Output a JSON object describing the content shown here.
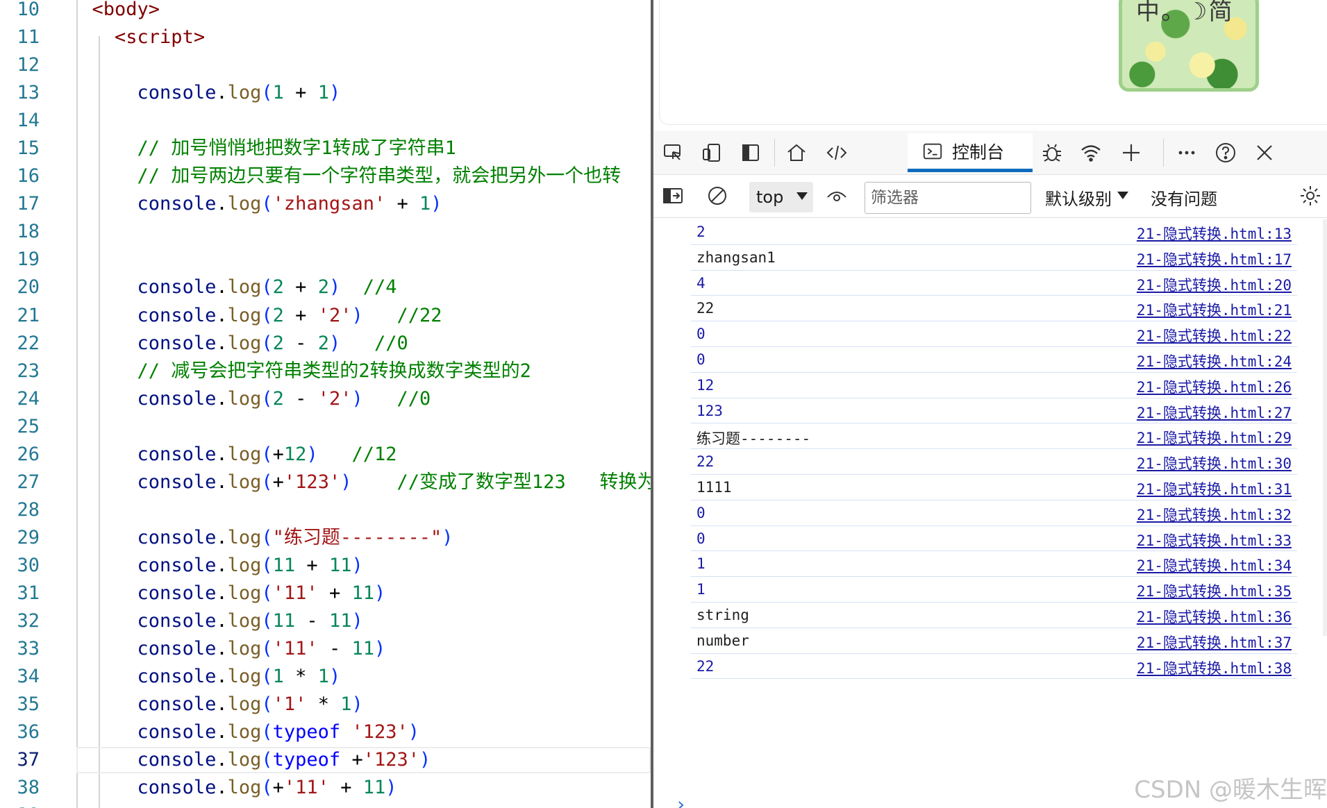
{
  "editor": {
    "lines": [
      {
        "n": "10",
        "tokens": [
          {
            "t": "  "
          },
          {
            "t": "<body>",
            "c": "tag"
          }
        ]
      },
      {
        "n": "11",
        "tokens": [
          {
            "t": "    "
          },
          {
            "t": "<script>",
            "c": "tag"
          }
        ]
      },
      {
        "n": "12",
        "tokens": []
      },
      {
        "n": "13",
        "tokens": [
          {
            "t": "      "
          },
          {
            "t": "console",
            "c": "obj"
          },
          {
            "t": ".",
            "c": "op"
          },
          {
            "t": "log",
            "c": "fn"
          },
          {
            "t": "(",
            "c": "pun"
          },
          {
            "t": "1",
            "c": "num"
          },
          {
            "t": " + ",
            "c": "op"
          },
          {
            "t": "1",
            "c": "num"
          },
          {
            "t": ")",
            "c": "pun"
          }
        ]
      },
      {
        "n": "14",
        "tokens": []
      },
      {
        "n": "15",
        "tokens": [
          {
            "t": "      "
          },
          {
            "t": "// 加号悄悄地把数字1转成了字符串1",
            "c": "cm"
          }
        ]
      },
      {
        "n": "16",
        "tokens": [
          {
            "t": "      "
          },
          {
            "t": "// 加号两边只要有一个字符串类型，就会把另外一个也转",
            "c": "cm"
          }
        ]
      },
      {
        "n": "17",
        "tokens": [
          {
            "t": "      "
          },
          {
            "t": "console",
            "c": "obj"
          },
          {
            "t": ".",
            "c": "op"
          },
          {
            "t": "log",
            "c": "fn"
          },
          {
            "t": "(",
            "c": "pun"
          },
          {
            "t": "'zhangsan'",
            "c": "str"
          },
          {
            "t": " + ",
            "c": "op"
          },
          {
            "t": "1",
            "c": "num"
          },
          {
            "t": ")",
            "c": "pun"
          }
        ]
      },
      {
        "n": "18",
        "tokens": []
      },
      {
        "n": "19",
        "tokens": []
      },
      {
        "n": "20",
        "tokens": [
          {
            "t": "      "
          },
          {
            "t": "console",
            "c": "obj"
          },
          {
            "t": ".",
            "c": "op"
          },
          {
            "t": "log",
            "c": "fn"
          },
          {
            "t": "(",
            "c": "pun"
          },
          {
            "t": "2",
            "c": "num"
          },
          {
            "t": " + ",
            "c": "op"
          },
          {
            "t": "2",
            "c": "num"
          },
          {
            "t": ")",
            "c": "pun"
          },
          {
            "t": "  //4",
            "c": "cm"
          }
        ]
      },
      {
        "n": "21",
        "tokens": [
          {
            "t": "      "
          },
          {
            "t": "console",
            "c": "obj"
          },
          {
            "t": ".",
            "c": "op"
          },
          {
            "t": "log",
            "c": "fn"
          },
          {
            "t": "(",
            "c": "pun"
          },
          {
            "t": "2",
            "c": "num"
          },
          {
            "t": " + ",
            "c": "op"
          },
          {
            "t": "'2'",
            "c": "str"
          },
          {
            "t": ")",
            "c": "pun"
          },
          {
            "t": "   //22",
            "c": "cm"
          }
        ]
      },
      {
        "n": "22",
        "tokens": [
          {
            "t": "      "
          },
          {
            "t": "console",
            "c": "obj"
          },
          {
            "t": ".",
            "c": "op"
          },
          {
            "t": "log",
            "c": "fn"
          },
          {
            "t": "(",
            "c": "pun"
          },
          {
            "t": "2",
            "c": "num"
          },
          {
            "t": " - ",
            "c": "op"
          },
          {
            "t": "2",
            "c": "num"
          },
          {
            "t": ")",
            "c": "pun"
          },
          {
            "t": "   //0",
            "c": "cm"
          }
        ]
      },
      {
        "n": "23",
        "tokens": [
          {
            "t": "      "
          },
          {
            "t": "// 减号会把字符串类型的2转换成数字类型的2",
            "c": "cm"
          }
        ]
      },
      {
        "n": "24",
        "tokens": [
          {
            "t": "      "
          },
          {
            "t": "console",
            "c": "obj"
          },
          {
            "t": ".",
            "c": "op"
          },
          {
            "t": "log",
            "c": "fn"
          },
          {
            "t": "(",
            "c": "pun"
          },
          {
            "t": "2",
            "c": "num"
          },
          {
            "t": " - ",
            "c": "op"
          },
          {
            "t": "'2'",
            "c": "str"
          },
          {
            "t": ")",
            "c": "pun"
          },
          {
            "t": "   //0",
            "c": "cm"
          }
        ]
      },
      {
        "n": "25",
        "tokens": []
      },
      {
        "n": "26",
        "tokens": [
          {
            "t": "      "
          },
          {
            "t": "console",
            "c": "obj"
          },
          {
            "t": ".",
            "c": "op"
          },
          {
            "t": "log",
            "c": "fn"
          },
          {
            "t": "(",
            "c": "pun"
          },
          {
            "t": "+",
            "c": "op"
          },
          {
            "t": "12",
            "c": "num"
          },
          {
            "t": ")",
            "c": "pun"
          },
          {
            "t": "   //12",
            "c": "cm"
          }
        ]
      },
      {
        "n": "27",
        "tokens": [
          {
            "t": "      "
          },
          {
            "t": "console",
            "c": "obj"
          },
          {
            "t": ".",
            "c": "op"
          },
          {
            "t": "log",
            "c": "fn"
          },
          {
            "t": "(",
            "c": "pun"
          },
          {
            "t": "+",
            "c": "op"
          },
          {
            "t": "'123'",
            "c": "str"
          },
          {
            "t": ")",
            "c": "pun"
          },
          {
            "t": "    //变成了数字型123   转换为",
            "c": "cm"
          }
        ]
      },
      {
        "n": "28",
        "tokens": []
      },
      {
        "n": "29",
        "tokens": [
          {
            "t": "      "
          },
          {
            "t": "console",
            "c": "obj"
          },
          {
            "t": ".",
            "c": "op"
          },
          {
            "t": "log",
            "c": "fn"
          },
          {
            "t": "(",
            "c": "pun"
          },
          {
            "t": "\"练习题--------\"",
            "c": "str"
          },
          {
            "t": ")",
            "c": "pun"
          }
        ]
      },
      {
        "n": "30",
        "tokens": [
          {
            "t": "      "
          },
          {
            "t": "console",
            "c": "obj"
          },
          {
            "t": ".",
            "c": "op"
          },
          {
            "t": "log",
            "c": "fn"
          },
          {
            "t": "(",
            "c": "pun"
          },
          {
            "t": "11",
            "c": "num"
          },
          {
            "t": " + ",
            "c": "op"
          },
          {
            "t": "11",
            "c": "num"
          },
          {
            "t": ")",
            "c": "pun"
          }
        ]
      },
      {
        "n": "31",
        "tokens": [
          {
            "t": "      "
          },
          {
            "t": "console",
            "c": "obj"
          },
          {
            "t": ".",
            "c": "op"
          },
          {
            "t": "log",
            "c": "fn"
          },
          {
            "t": "(",
            "c": "pun"
          },
          {
            "t": "'11'",
            "c": "str"
          },
          {
            "t": " + ",
            "c": "op"
          },
          {
            "t": "11",
            "c": "num"
          },
          {
            "t": ")",
            "c": "pun"
          }
        ]
      },
      {
        "n": "32",
        "tokens": [
          {
            "t": "      "
          },
          {
            "t": "console",
            "c": "obj"
          },
          {
            "t": ".",
            "c": "op"
          },
          {
            "t": "log",
            "c": "fn"
          },
          {
            "t": "(",
            "c": "pun"
          },
          {
            "t": "11",
            "c": "num"
          },
          {
            "t": " - ",
            "c": "op"
          },
          {
            "t": "11",
            "c": "num"
          },
          {
            "t": ")",
            "c": "pun"
          }
        ]
      },
      {
        "n": "33",
        "tokens": [
          {
            "t": "      "
          },
          {
            "t": "console",
            "c": "obj"
          },
          {
            "t": ".",
            "c": "op"
          },
          {
            "t": "log",
            "c": "fn"
          },
          {
            "t": "(",
            "c": "pun"
          },
          {
            "t": "'11'",
            "c": "str"
          },
          {
            "t": " - ",
            "c": "op"
          },
          {
            "t": "11",
            "c": "num"
          },
          {
            "t": ")",
            "c": "pun"
          }
        ]
      },
      {
        "n": "34",
        "tokens": [
          {
            "t": "      "
          },
          {
            "t": "console",
            "c": "obj"
          },
          {
            "t": ".",
            "c": "op"
          },
          {
            "t": "log",
            "c": "fn"
          },
          {
            "t": "(",
            "c": "pun"
          },
          {
            "t": "1",
            "c": "num"
          },
          {
            "t": " * ",
            "c": "op"
          },
          {
            "t": "1",
            "c": "num"
          },
          {
            "t": ")",
            "c": "pun"
          }
        ]
      },
      {
        "n": "35",
        "tokens": [
          {
            "t": "      "
          },
          {
            "t": "console",
            "c": "obj"
          },
          {
            "t": ".",
            "c": "op"
          },
          {
            "t": "log",
            "c": "fn"
          },
          {
            "t": "(",
            "c": "pun"
          },
          {
            "t": "'1'",
            "c": "str"
          },
          {
            "t": " * ",
            "c": "op"
          },
          {
            "t": "1",
            "c": "num"
          },
          {
            "t": ")",
            "c": "pun"
          }
        ]
      },
      {
        "n": "36",
        "tokens": [
          {
            "t": "      "
          },
          {
            "t": "console",
            "c": "obj"
          },
          {
            "t": ".",
            "c": "op"
          },
          {
            "t": "log",
            "c": "fn"
          },
          {
            "t": "(",
            "c": "pun"
          },
          {
            "t": "typeof",
            "c": "kw"
          },
          {
            "t": " ",
            "c": "op"
          },
          {
            "t": "'123'",
            "c": "str"
          },
          {
            "t": ")",
            "c": "pun"
          }
        ]
      },
      {
        "n": "37",
        "active": true,
        "tokens": [
          {
            "t": "      "
          },
          {
            "t": "console",
            "c": "obj"
          },
          {
            "t": ".",
            "c": "op"
          },
          {
            "t": "log",
            "c": "fn"
          },
          {
            "t": "(",
            "c": "pun"
          },
          {
            "t": "typeof",
            "c": "kw"
          },
          {
            "t": " +",
            "c": "op"
          },
          {
            "t": "'123'",
            "c": "str"
          },
          {
            "t": ")",
            "c": "pun"
          }
        ]
      },
      {
        "n": "38",
        "tokens": [
          {
            "t": "      "
          },
          {
            "t": "console",
            "c": "obj"
          },
          {
            "t": ".",
            "c": "op"
          },
          {
            "t": "log",
            "c": "fn"
          },
          {
            "t": "(",
            "c": "pun"
          },
          {
            "t": "+",
            "c": "op"
          },
          {
            "t": "'11'",
            "c": "str"
          },
          {
            "t": " + ",
            "c": "op"
          },
          {
            "t": "11",
            "c": "num"
          },
          {
            "t": ")",
            "c": "pun"
          }
        ]
      },
      {
        "n": "39",
        "tokens": []
      }
    ]
  },
  "page_preview": {
    "image_text": "中。☽简"
  },
  "devtools": {
    "tabs": {
      "console_label": "控制台"
    },
    "toolbar": {
      "context": "top",
      "filter_placeholder": "筛选器",
      "level": "默认级别",
      "issues": "没有问题"
    },
    "console": [
      {
        "value": "2",
        "kind": "num",
        "source": "21-隐式转换.html:13"
      },
      {
        "value": "zhangsan1",
        "kind": "str",
        "source": "21-隐式转换.html:17"
      },
      {
        "value": "4",
        "kind": "num",
        "source": "21-隐式转换.html:20"
      },
      {
        "value": "22",
        "kind": "str",
        "source": "21-隐式转换.html:21"
      },
      {
        "value": "0",
        "kind": "num",
        "source": "21-隐式转换.html:22"
      },
      {
        "value": "0",
        "kind": "num",
        "source": "21-隐式转换.html:24"
      },
      {
        "value": "12",
        "kind": "num",
        "source": "21-隐式转换.html:26"
      },
      {
        "value": "123",
        "kind": "num",
        "source": "21-隐式转换.html:27"
      },
      {
        "value": "练习题--------",
        "kind": "str",
        "source": "21-隐式转换.html:29"
      },
      {
        "value": "22",
        "kind": "num",
        "source": "21-隐式转换.html:30"
      },
      {
        "value": "1111",
        "kind": "str",
        "source": "21-隐式转换.html:31"
      },
      {
        "value": "0",
        "kind": "num",
        "source": "21-隐式转换.html:32"
      },
      {
        "value": "0",
        "kind": "num",
        "source": "21-隐式转换.html:33"
      },
      {
        "value": "1",
        "kind": "num",
        "source": "21-隐式转换.html:34"
      },
      {
        "value": "1",
        "kind": "num",
        "source": "21-隐式转换.html:35"
      },
      {
        "value": "string",
        "kind": "str",
        "source": "21-隐式转换.html:36"
      },
      {
        "value": "number",
        "kind": "str",
        "source": "21-隐式转换.html:37"
      },
      {
        "value": "22",
        "kind": "num",
        "source": "21-隐式转换.html:38"
      }
    ],
    "prompt": "›"
  },
  "watermark": "CSDN @暖木生晖",
  "colors": {
    "accent": "#0f6cbd",
    "string": "#a31515",
    "number": "#098658",
    "comment": "#008000",
    "link": "#1a1aa6"
  }
}
